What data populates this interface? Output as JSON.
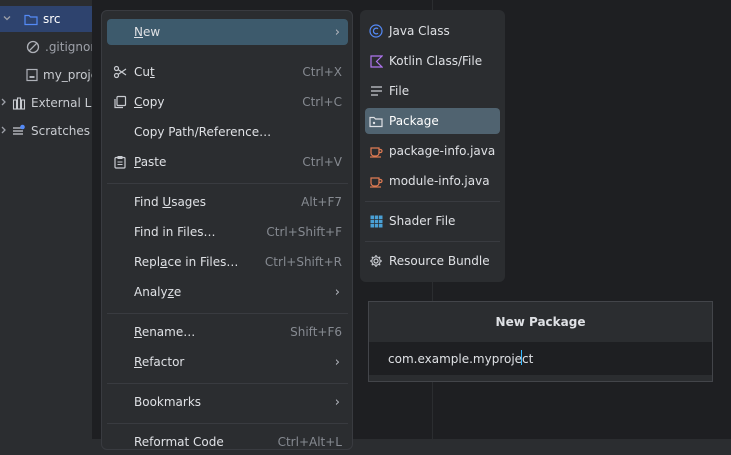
{
  "project_tree": {
    "items": [
      {
        "label": "src",
        "icon": "folder-icon",
        "chevron": "expanded"
      },
      {
        "label": ".gitignore",
        "icon": "ignored-file-icon"
      },
      {
        "label": "my_project.iml",
        "icon": "module-file-icon"
      },
      {
        "label": "External Libraries",
        "icon": "library-icon",
        "chevron": "collapsed"
      },
      {
        "label": "Scratches and Consoles",
        "icon": "scratches-icon",
        "chevron": "collapsed"
      }
    ]
  },
  "context_menu": {
    "new": {
      "label": "New",
      "mnemonic": "N",
      "rest": "ew"
    },
    "cut": {
      "label": "Cut",
      "pre": "Cu",
      "mnemonic": "t",
      "shortcut": "Ctrl+X"
    },
    "copy": {
      "label": "Copy",
      "mnemonic": "C",
      "rest": "opy",
      "shortcut": "Ctrl+C"
    },
    "copy_path": {
      "label": "Copy Path/Reference…"
    },
    "paste": {
      "label": "Paste",
      "mnemonic": "P",
      "rest": "aste",
      "shortcut": "Ctrl+V"
    },
    "find_usages": {
      "label": "Find Usages",
      "pre": "Find ",
      "mnemonic": "U",
      "rest": "sages",
      "shortcut": "Alt+F7"
    },
    "find_in_files": {
      "label": "Find in Files…",
      "shortcut": "Ctrl+Shift+F"
    },
    "replace_in_files": {
      "label": "Replace in Files…",
      "pre": "Repl",
      "mnemonic": "a",
      "rest": "ce in Files…",
      "shortcut": "Ctrl+Shift+R"
    },
    "analyze": {
      "label": "Analyze",
      "pre": "Analy",
      "mnemonic": "z",
      "rest": "e"
    },
    "rename": {
      "label": "Rename…",
      "mnemonic": "R",
      "rest": "ename…",
      "shortcut": "Shift+F6"
    },
    "refactor": {
      "label": "Refactor",
      "mnemonic": "R",
      "rest": "efactor"
    },
    "bookmarks": {
      "label": "Bookmarks"
    },
    "reformat_code": {
      "label": "Reformat Code",
      "shortcut": "Ctrl+Alt+L"
    }
  },
  "new_submenu": {
    "items": [
      {
        "label": "Java Class",
        "icon": "java-class-icon"
      },
      {
        "label": "Kotlin Class/File",
        "icon": "kotlin-icon"
      },
      {
        "label": "File",
        "icon": "file-lines-icon"
      },
      {
        "label": "Package",
        "icon": "package-folder-icon",
        "selected": true
      },
      {
        "label": "package-info.java",
        "icon": "java-cup-icon"
      },
      {
        "label": "module-info.java",
        "icon": "java-cup-icon"
      },
      {
        "label": "Shader File",
        "icon": "shader-grid-icon"
      },
      {
        "label": "Resource Bundle",
        "icon": "gear-icon"
      }
    ]
  },
  "new_package_popup": {
    "title": "New Package",
    "input_value": "com.example.myproject"
  },
  "colors": {
    "selection": "#3d5a6c",
    "submenu_selection": "#506370",
    "accent_caret": "#35b8ff",
    "java_icon": "#548af7",
    "kotlin_icon": "#b075f0",
    "cup_icon": "#e07b53",
    "shader_icon": "#4aa0d5"
  }
}
